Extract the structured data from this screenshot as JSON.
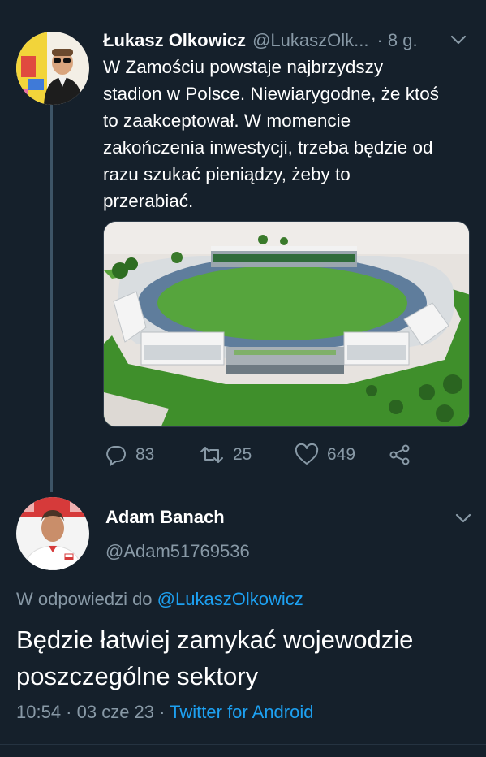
{
  "tweet": {
    "author_name": "Łukasz Olkowicz",
    "author_handle": "@LukaszOlk...",
    "time": "· 8 g.",
    "text": "W Zamościu powstaje najbrzydszy stadion w Polsce. Niewiarygodne, że ktoś to zaakceptował. W momencie zakończenia inwestycji, trzeba będzie od razu szukać pieniądzy, żeby to przerabiać.",
    "media_icon": "stadium-render-image",
    "actions": {
      "replies": "83",
      "retweets": "25",
      "likes": "649"
    }
  },
  "reply": {
    "author_name": "Adam Banach",
    "author_handle": "@Adam51769536",
    "replying_to_prefix": "W odpowiedzi do",
    "replying_to_handle": "@LukaszOlkowicz",
    "text": "Będzie łatwiej zamykać wojewodzie poszczególne sektory",
    "timestamp": "10:54 · 03 cze 23 ·",
    "source": "Twitter for Android"
  },
  "colors": {
    "background": "#15202b",
    "secondary_text": "#8899a6",
    "link": "#1da1f2",
    "divider": "#253341"
  }
}
